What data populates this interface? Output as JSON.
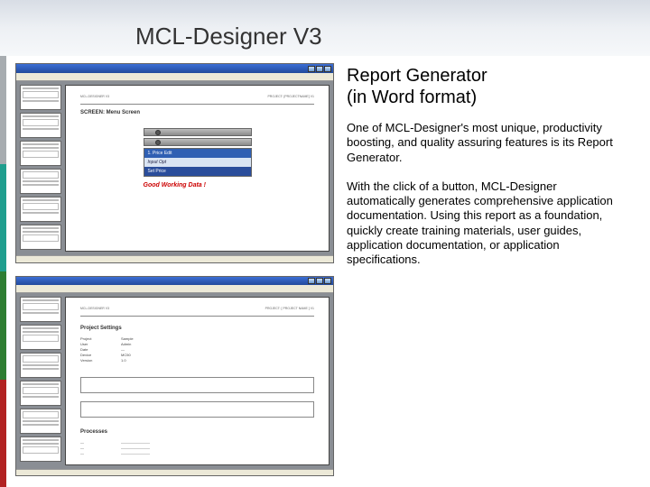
{
  "header": {
    "title": "MCL-Designer V3"
  },
  "screenshots": {
    "shot1": {
      "pageHeaderLeft": "MCL-DESIGNER V3",
      "pageHeaderRight": "PROJECT: [PROJECTNAME] V1",
      "pageSub": "SCREEN: Menu Screen",
      "device_r1": "1. Price Edit",
      "device_r2": "Input Opt",
      "device_r3": "Set Price",
      "callout": "Good Working Data !"
    },
    "shot2": {
      "pageHeaderLeft": "MCL-DESIGNER V3",
      "pageHeaderRight": "PROJECT: [ PROJECT NAME ] V1",
      "sec1": "Project Settings",
      "meta": {
        "k1": "Project",
        "v1": "Sample",
        "k2": "User",
        "v2": "Admin",
        "k3": "Date",
        "v3": "—",
        "k4": "Device",
        "v4": "MC50",
        "k5": "Version",
        "v5": "1.0"
      },
      "sec2": "Processes"
    }
  },
  "right": {
    "title_l1": "Report Generator",
    "title_l2": "(in Word format)",
    "para1": "One of MCL-Designer's most unique, productivity boosting, and quality assuring features is its Report Generator.",
    "para2": "With the click of a button, MCL-Designer automatically generates comprehensive application documentation. Using this report as a foundation, quickly create training materials, user guides, application documentation, or application specifications."
  }
}
